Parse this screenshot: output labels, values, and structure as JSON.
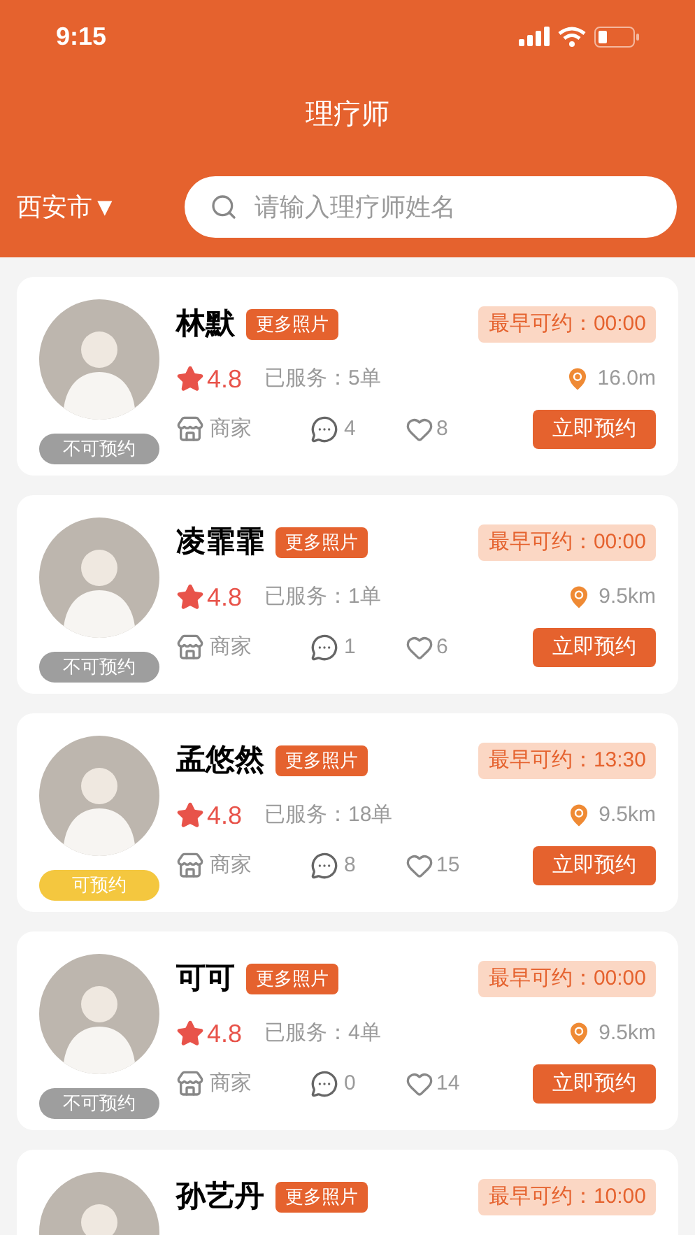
{
  "status_bar": {
    "time": "9:15"
  },
  "header": {
    "title": "理疗师",
    "city": "西安市",
    "city_caret": "▼",
    "search": {
      "placeholder": "请输入理疗师姓名"
    }
  },
  "therapists": [
    {
      "name": "林默",
      "photos_label": "更多照片",
      "earliest": "最早可约：00:00",
      "rating": "4.8",
      "served": "已服务：5单",
      "distance": "16.0m",
      "shop": "商家",
      "comments": "4",
      "likes": "8",
      "book_label": "立即预约",
      "status": {
        "label": "不可预约",
        "available": false
      }
    },
    {
      "name": "凌霏霏",
      "photos_label": "更多照片",
      "earliest": "最早可约：00:00",
      "rating": "4.8",
      "served": "已服务：1单",
      "distance": "9.5km",
      "shop": "商家",
      "comments": "1",
      "likes": "6",
      "book_label": "立即预约",
      "status": {
        "label": "不可预约",
        "available": false
      }
    },
    {
      "name": "孟悠然",
      "photos_label": "更多照片",
      "earliest": "最早可约：13:30",
      "rating": "4.8",
      "served": "已服务：18单",
      "distance": "9.5km",
      "shop": "商家",
      "comments": "8",
      "likes": "15",
      "book_label": "立即预约",
      "status": {
        "label": "可预约",
        "available": true
      }
    },
    {
      "name": "可可",
      "photos_label": "更多照片",
      "earliest": "最早可约：00:00",
      "rating": "4.8",
      "served": "已服务：4单",
      "distance": "9.5km",
      "shop": "商家",
      "comments": "0",
      "likes": "14",
      "book_label": "立即预约",
      "status": {
        "label": "不可预约",
        "available": false
      }
    },
    {
      "name": "孙艺丹",
      "photos_label": "更多照片",
      "earliest": "最早可约：10:00"
    }
  ]
}
